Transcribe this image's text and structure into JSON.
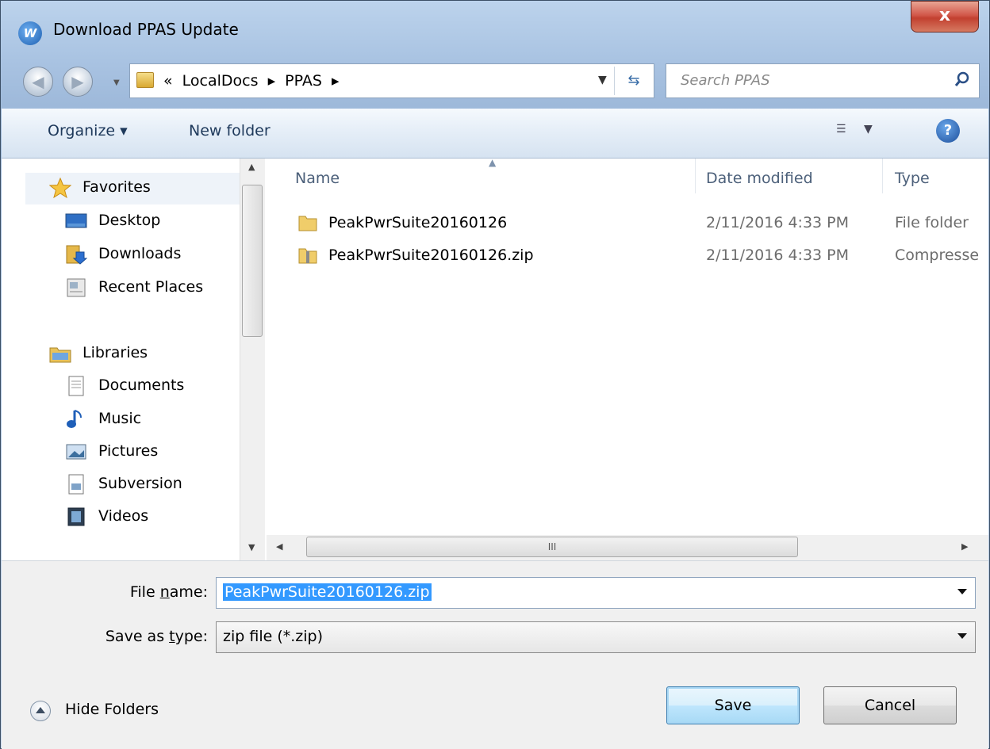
{
  "window": {
    "title": "Download PPAS Update",
    "close_label": "x"
  },
  "navigation": {
    "breadcrumb": [
      "«",
      "LocalDocs",
      "▸",
      "PPAS",
      "▸"
    ],
    "search_placeholder": "Search PPAS"
  },
  "toolbar": {
    "organize_label": "Organize ▾",
    "new_folder_label": "New folder",
    "help_label": "?"
  },
  "sidebar": {
    "favorites": {
      "label": "Favorites",
      "items": [
        {
          "label": "Desktop",
          "icon": "desktop-icon"
        },
        {
          "label": "Downloads",
          "icon": "downloads-icon"
        },
        {
          "label": "Recent Places",
          "icon": "recent-places-icon"
        }
      ]
    },
    "libraries": {
      "label": "Libraries",
      "items": [
        {
          "label": "Documents",
          "icon": "documents-icon"
        },
        {
          "label": "Music",
          "icon": "music-icon"
        },
        {
          "label": "Pictures",
          "icon": "pictures-icon"
        },
        {
          "label": "Subversion",
          "icon": "subversion-icon"
        },
        {
          "label": "Videos",
          "icon": "videos-icon"
        }
      ]
    }
  },
  "file_list": {
    "columns": [
      "Name",
      "Date modified",
      "Type"
    ],
    "rows": [
      {
        "name": "PeakPwrSuite20160126",
        "date": "2/11/2016 4:33 PM",
        "type": "File folder",
        "icon": "folder-icon"
      },
      {
        "name": "PeakPwrSuite20160126.zip",
        "date": "2/11/2016 4:33 PM",
        "type": "Compresse",
        "icon": "zip-folder-icon"
      }
    ]
  },
  "save_form": {
    "file_name_label_pre": "File ",
    "file_name_label_u": "n",
    "file_name_label_post": "ame:",
    "file_name_value": "PeakPwrSuite20160126.zip",
    "save_type_label_pre": "Save as ",
    "save_type_label_u": "t",
    "save_type_label_post": "ype:",
    "save_type_value": "zip file (*.zip)"
  },
  "actions": {
    "hide_folders_label": "Hide Folders",
    "save_label": "Save",
    "cancel_label": "Cancel"
  },
  "colors": {
    "selection": "#3399ff",
    "title_close": "#c2402f",
    "toolbar_text": "#1e395b"
  }
}
